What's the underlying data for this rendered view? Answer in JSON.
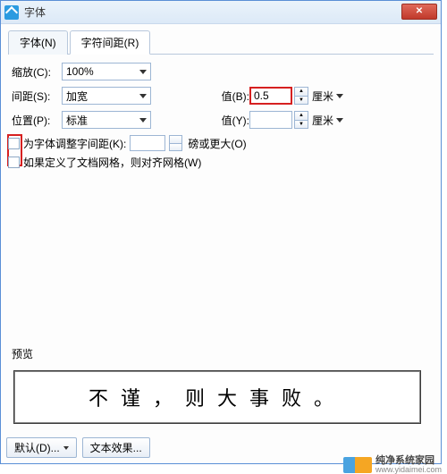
{
  "window": {
    "title": "字体"
  },
  "tabs": {
    "font": "字体(N)",
    "spacing": "字符间距(R)"
  },
  "form": {
    "scale_label": "缩放(C):",
    "scale_value": "100%",
    "spacing_label": "间距(S):",
    "spacing_value": "加宽",
    "position_label": "位置(P):",
    "position_value": "标准",
    "value_b_label": "值(B):",
    "value_b": "0.5",
    "unit_cm": "厘米",
    "value_y_label": "值(Y):",
    "value_y": ""
  },
  "checks": {
    "kerning": "为字体调整字间距(K):",
    "kerning_suffix": "磅或更大(O)",
    "snap_grid": "如果定义了文档网格，则对齐网格(W)"
  },
  "preview": {
    "label": "预览",
    "text": "不谨，则大事败。"
  },
  "buttons": {
    "default": "默认(D)...",
    "text_effect": "文本效果..."
  },
  "watermark": {
    "name": "纯净系统家园",
    "url": "www.yidaimei.com"
  }
}
